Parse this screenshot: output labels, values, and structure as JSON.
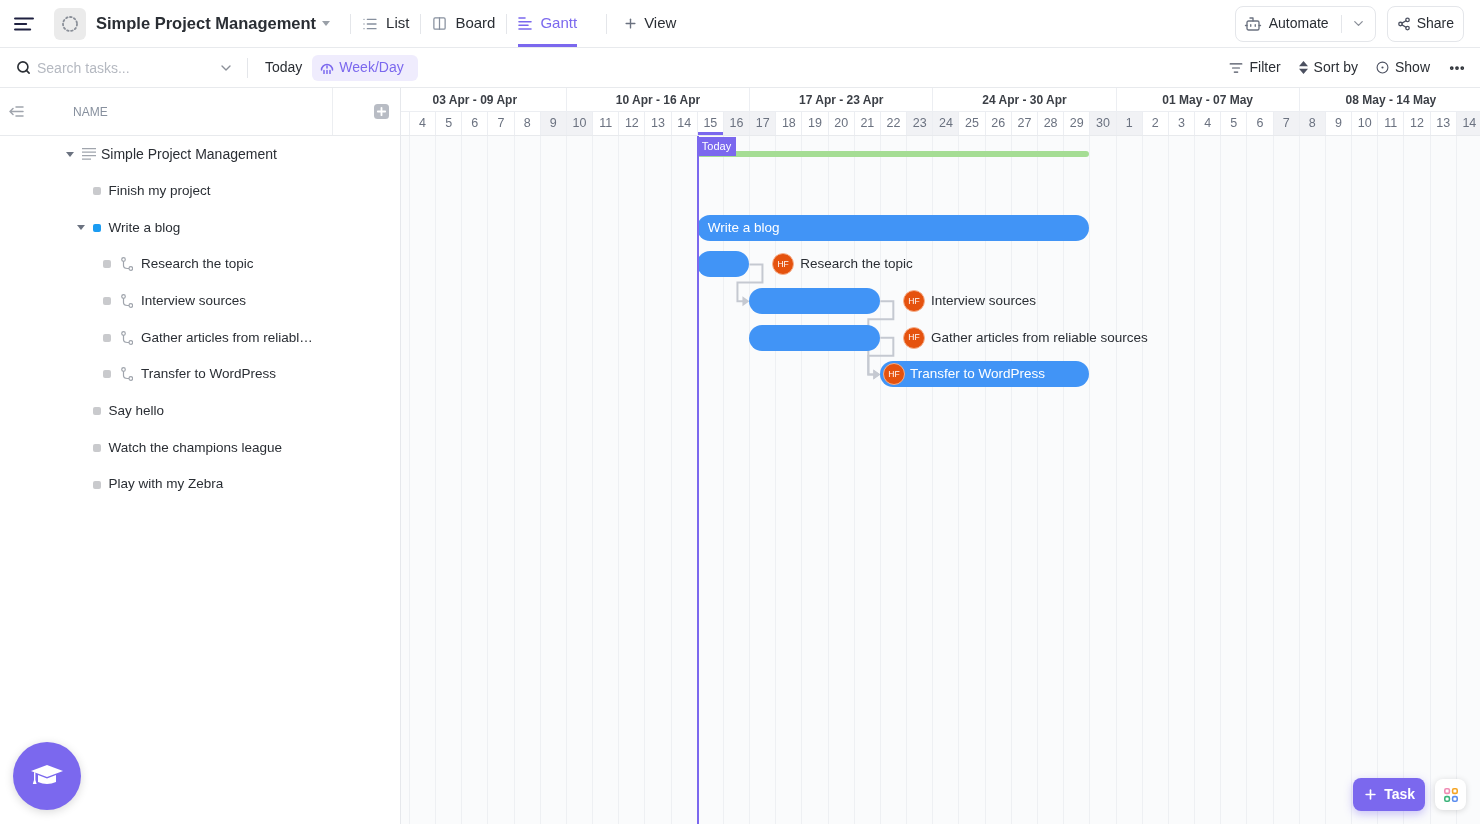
{
  "header": {
    "title": "Simple Project Management",
    "views": [
      {
        "kind": "list",
        "label": "List",
        "selected": false
      },
      {
        "kind": "board",
        "label": "Board",
        "selected": false
      },
      {
        "kind": "gantt",
        "label": "Gantt",
        "selected": true
      }
    ],
    "add_view": "View",
    "automate": "Automate",
    "share": "Share"
  },
  "toolbar": {
    "search": {
      "placeholder": "Search tasks..."
    },
    "today_button": "Today",
    "scale": {
      "label": "Week/Day",
      "selected": true
    },
    "actions": [
      {
        "kind": "filter",
        "label": "Filter"
      },
      {
        "kind": "sort",
        "label": "Sort by"
      },
      {
        "kind": "show",
        "label": "Show"
      }
    ]
  },
  "task_list": {
    "column": "NAME",
    "tasks": [
      {
        "kind": "list",
        "name": "Simple Project Management",
        "expanded": true,
        "bar": {
          "kind": "summary"
        },
        "children": [
          {
            "kind": "task",
            "name": "Finish my project",
            "color": "#c9cacd"
          },
          {
            "kind": "task",
            "name": "Write a blog",
            "color": "#1b9cf2",
            "expanded": true,
            "bar": {
              "kind": "task",
              "label": "Write a blog",
              "label_inside": true
            },
            "children": [
              {
                "kind": "subtask",
                "name": "Research the topic",
                "color": "#c9cacd",
                "bar": {
                  "kind": "task",
                  "label": "Research the topic",
                  "assignee": "HF",
                  "label_inside": false,
                  "incoming": false,
                  "outgoing": true
                }
              },
              {
                "kind": "subtask",
                "name": "Interview sources",
                "color": "#c9cacd",
                "bar": {
                  "kind": "task",
                  "label": "Interview sources",
                  "assignee": "HF",
                  "label_inside": false,
                  "incoming": true,
                  "outgoing": true
                }
              },
              {
                "kind": "subtask",
                "name": "Gather articles from reliabl…",
                "color": "#c9cacd",
                "bar": {
                  "kind": "task",
                  "label": "Gather articles from reliable sources",
                  "assignee": "HF",
                  "label_inside": false,
                  "incoming": false,
                  "outgoing": true
                }
              },
              {
                "kind": "subtask",
                "name": "Transfer to WordPress",
                "color": "#c9cacd",
                "bar": {
                  "kind": "task",
                  "label": "Transfer to WordPress",
                  "assignee": "HF",
                  "label_inside": true,
                  "incoming": true,
                  "outgoing": false
                }
              }
            ]
          },
          {
            "kind": "task",
            "name": "Say hello",
            "color": "#c9cacd"
          },
          {
            "kind": "task",
            "name": "Watch the champions league",
            "color": "#c9cacd"
          },
          {
            "kind": "task",
            "name": "Play with my Zebra",
            "color": "#c9cacd"
          }
        ]
      }
    ]
  },
  "gantt": {
    "today_label": "Today",
    "weeks": [
      {
        "label": "03 Apr - 09 Apr",
        "days": [
          {
            "label": "4",
            "shaded": false,
            "today": false
          },
          {
            "label": "5",
            "shaded": false,
            "today": false
          },
          {
            "label": "6",
            "shaded": false,
            "today": false
          },
          {
            "label": "7",
            "shaded": false,
            "today": false
          },
          {
            "label": "8",
            "shaded": false,
            "today": false
          },
          {
            "label": "9",
            "shaded": true,
            "today": false
          }
        ]
      },
      {
        "label": "10 Apr - 16 Apr",
        "days": [
          {
            "label": "10",
            "shaded": true,
            "today": false
          },
          {
            "label": "11",
            "shaded": false,
            "today": false
          },
          {
            "label": "12",
            "shaded": false,
            "today": false
          },
          {
            "label": "13",
            "shaded": false,
            "today": false
          },
          {
            "label": "14",
            "shaded": false,
            "today": false
          },
          {
            "label": "15",
            "shaded": false,
            "today": true
          },
          {
            "label": "16",
            "shaded": true,
            "today": false
          }
        ]
      },
      {
        "label": "17 Apr - 23 Apr",
        "days": [
          {
            "label": "17",
            "shaded": true,
            "today": false
          },
          {
            "label": "18",
            "shaded": false,
            "today": false
          },
          {
            "label": "19",
            "shaded": false,
            "today": false
          },
          {
            "label": "20",
            "shaded": false,
            "today": false
          },
          {
            "label": "21",
            "shaded": false,
            "today": false
          },
          {
            "label": "22",
            "shaded": false,
            "today": false
          },
          {
            "label": "23",
            "shaded": true,
            "today": false
          }
        ]
      },
      {
        "label": "24 Apr - 30 Apr",
        "days": [
          {
            "label": "24",
            "shaded": true,
            "today": false
          },
          {
            "label": "25",
            "shaded": false,
            "today": false
          },
          {
            "label": "26",
            "shaded": false,
            "today": false
          },
          {
            "label": "27",
            "shaded": false,
            "today": false
          },
          {
            "label": "28",
            "shaded": false,
            "today": false
          },
          {
            "label": "29",
            "shaded": false,
            "today": false
          },
          {
            "label": "30",
            "shaded": true,
            "today": false
          }
        ]
      },
      {
        "label": "01 May - 07 May",
        "days": [
          {
            "label": "1",
            "shaded": true,
            "today": false
          },
          {
            "label": "2",
            "shaded": false,
            "today": false
          },
          {
            "label": "3",
            "shaded": false,
            "today": false
          },
          {
            "label": "4",
            "shaded": false,
            "today": false
          },
          {
            "label": "5",
            "shaded": false,
            "today": false
          },
          {
            "label": "6",
            "shaded": false,
            "today": false
          },
          {
            "label": "7",
            "shaded": true,
            "today": false
          }
        ]
      },
      {
        "label": "08 May - 14 May",
        "days": [
          {
            "label": "8",
            "shaded": true,
            "today": false
          },
          {
            "label": "9",
            "shaded": false,
            "today": false
          },
          {
            "label": "10",
            "shaded": false,
            "today": false
          },
          {
            "label": "11",
            "shaded": false,
            "today": false
          },
          {
            "label": "12",
            "shaded": false,
            "today": false
          },
          {
            "label": "13",
            "shaded": false,
            "today": false
          },
          {
            "label": "14",
            "shaded": true,
            "today": false
          }
        ]
      }
    ]
  },
  "add_task_button": "Task"
}
